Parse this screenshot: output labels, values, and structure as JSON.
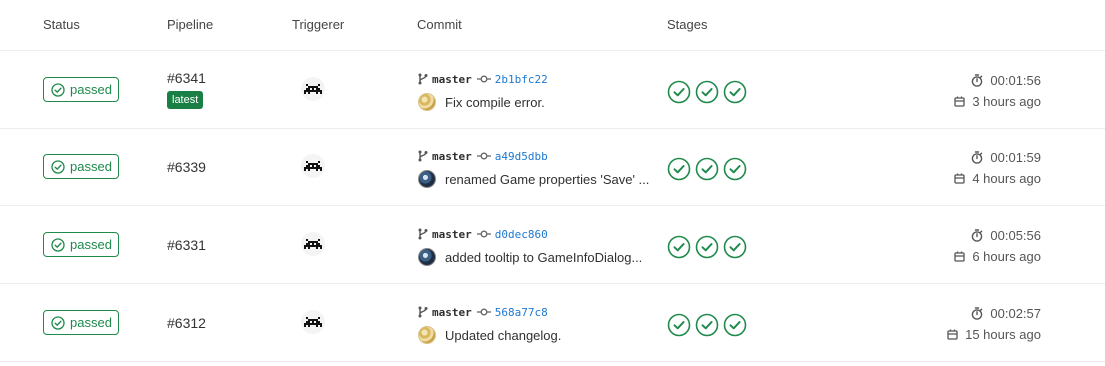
{
  "headers": {
    "status": "Status",
    "pipeline": "Pipeline",
    "triggerer": "Triggerer",
    "commit": "Commit",
    "stages": "Stages"
  },
  "colors": {
    "success": "#1f8a4c",
    "latest_badge": "#1a7f45",
    "sha_link": "#1f78d1"
  },
  "rows": [
    {
      "status": "passed",
      "pipeline_id": "#6341",
      "badge": "latest",
      "branch": "master",
      "sha": "2b1bfc22",
      "message": "Fix compile error.",
      "author_avatar": "gold-pattern-avatar-icon",
      "stages": [
        "passed",
        "passed",
        "passed"
      ],
      "duration": "00:01:56",
      "finished": "3 hours ago"
    },
    {
      "status": "passed",
      "pipeline_id": "#6339",
      "badge": "",
      "branch": "master",
      "sha": "a49d5dbb",
      "message": "renamed Game properties 'Save' ...",
      "author_avatar": "dark-photo-avatar-icon",
      "stages": [
        "passed",
        "passed",
        "passed"
      ],
      "duration": "00:01:59",
      "finished": "4 hours ago"
    },
    {
      "status": "passed",
      "pipeline_id": "#6331",
      "badge": "",
      "branch": "master",
      "sha": "d0dec860",
      "message": "added tooltip to GameInfoDialog...",
      "author_avatar": "dark-photo-avatar-icon",
      "stages": [
        "passed",
        "passed",
        "passed"
      ],
      "duration": "00:05:56",
      "finished": "6 hours ago"
    },
    {
      "status": "passed",
      "pipeline_id": "#6312",
      "badge": "",
      "branch": "master",
      "sha": "568a77c8",
      "message": "Updated changelog.",
      "author_avatar": "gold-pattern-avatar-icon",
      "stages": [
        "passed",
        "passed",
        "passed"
      ],
      "duration": "00:02:57",
      "finished": "15 hours ago"
    }
  ]
}
